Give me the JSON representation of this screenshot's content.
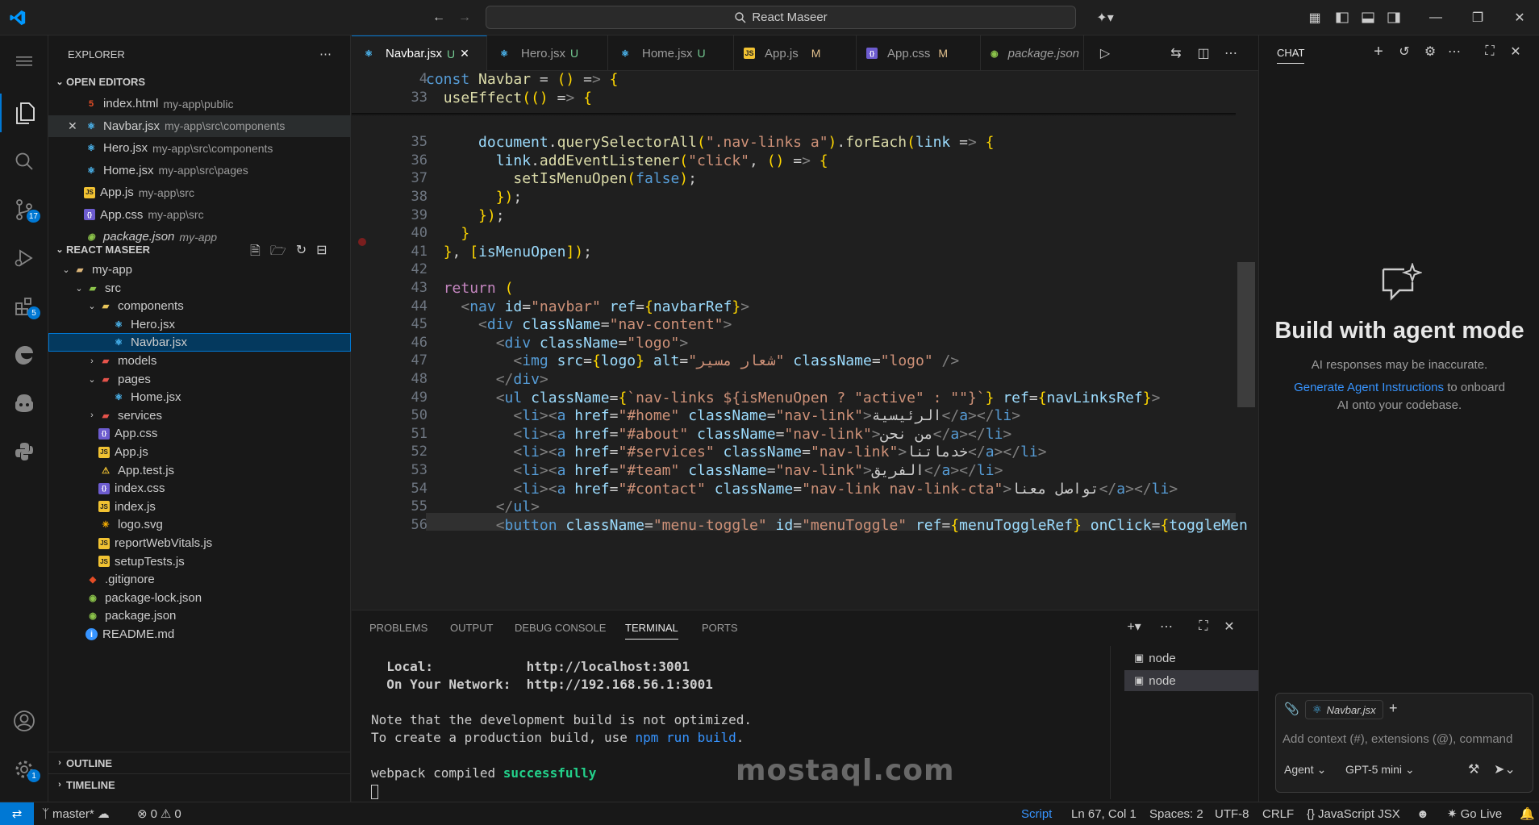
{
  "titlebar": {
    "search_text": "React Maseer"
  },
  "activity": {
    "scm_badge": "17",
    "ext_badge": "5",
    "settings_badge": "1"
  },
  "sidebar": {
    "title": "EXPLORER",
    "open_editors_title": "OPEN EDITORS",
    "open_editors": [
      {
        "name": "index.html",
        "desc": "my-app\\public"
      },
      {
        "name": "Navbar.jsx",
        "desc": "my-app\\src\\components"
      },
      {
        "name": "Hero.jsx",
        "desc": "my-app\\src\\components"
      },
      {
        "name": "Home.jsx",
        "desc": "my-app\\src\\pages"
      },
      {
        "name": "App.js",
        "desc": "my-app\\src"
      },
      {
        "name": "App.css",
        "desc": "my-app\\src"
      },
      {
        "name": "package.json",
        "desc": "my-app"
      }
    ],
    "project_title": "REACT MASEER",
    "tree": [
      "my-app",
      "src",
      "components",
      "Hero.jsx",
      "Navbar.jsx",
      "models",
      "pages",
      "Home.jsx",
      "services",
      "App.css",
      "App.js",
      "App.test.js",
      "index.css",
      "index.js",
      "logo.svg",
      "reportWebVitals.js",
      "setupTests.js",
      ".gitignore",
      "package-lock.json",
      "package.json",
      "README.md"
    ],
    "outline_title": "OUTLINE",
    "timeline_title": "TIMELINE"
  },
  "tabs": [
    {
      "name": "Navbar.jsx",
      "status": "U"
    },
    {
      "name": "Hero.jsx",
      "status": "U"
    },
    {
      "name": "Home.jsx",
      "status": "U"
    },
    {
      "name": "App.js",
      "status": "M"
    },
    {
      "name": "App.css",
      "status": "M"
    },
    {
      "name": "package.json",
      "status": ""
    }
  ],
  "code": {
    "line_numbers": [
      "4",
      "33",
      "35",
      "36",
      "37",
      "38",
      "39",
      "40",
      "41",
      "42",
      "43",
      "44",
      "45",
      "46",
      "47",
      "48",
      "49",
      "50",
      "51",
      "52",
      "53",
      "54",
      "55",
      "56"
    ],
    "lines": [
      "const Navbar = () => {",
      "  useEffect(() => {",
      "      document.querySelectorAll(\".nav-links a\").forEach(link => {",
      "        link.addEventListener(\"click\", () => {",
      "          setIsMenuOpen(false);",
      "        });",
      "      });",
      "    }",
      "  }, [isMenuOpen]);",
      "",
      "  return (",
      "    <nav id=\"navbar\" ref={navbarRef}>",
      "      <div className=\"nav-content\">",
      "        <div className=\"logo\">",
      "          <img src={logo} alt=\"شعار مسير\" className=\"logo\" />",
      "        </div>",
      "        <ul className={`nav-links ${isMenuOpen ? \"active\" : \"\"}`} ref={navLinksRef}>",
      "          <li><a href=\"#home\" className=\"nav-link\">الرئيسية</a></li>",
      "          <li><a href=\"#about\" className=\"nav-link\">من نحن</a></li>",
      "          <li><a href=\"#services\" className=\"nav-link\">خدماتنا</a></li>",
      "          <li><a href=\"#team\" className=\"nav-link\">الفريق</a></li>",
      "          <li><a href=\"#contact\" className=\"nav-link nav-link-cta\">تواصل معنا</a></li>",
      "        </ul>",
      "        <button className=\"menu-toggle\" id=\"menuToggle\" ref={menuToggleRef} onClick={toggleMen"
    ]
  },
  "panel": {
    "tabs": [
      "PROBLEMS",
      "OUTPUT",
      "DEBUG CONSOLE",
      "TERMINAL",
      "PORTS"
    ],
    "terminal_lines": [
      "  Local:            http://localhost:3001",
      "  On Your Network:  http://192.168.56.1:3001",
      "",
      "Note that the development build is not optimized.",
      "To create a production build, use npm run build.",
      "",
      "webpack compiled successfully"
    ],
    "terminals": [
      "node",
      "node"
    ]
  },
  "chat": {
    "header": "CHAT",
    "heading": "Build with agent mode",
    "sub1": "AI responses may be inaccurate.",
    "link": "Generate Agent Instructions",
    "sub2": "to onboard",
    "sub3": "AI onto your codebase.",
    "context_file": "Navbar.jsx",
    "input_placeholder": "Add context (#), extensions (@), command",
    "mode": "Agent",
    "model": "GPT-5 mini"
  },
  "status": {
    "branch": "master*",
    "errors": "0",
    "warnings": "0",
    "script": "Script",
    "position": "Ln 67, Col 1",
    "spaces": "Spaces: 2",
    "encoding": "UTF-8",
    "eol": "CRLF",
    "language": "JavaScript JSX",
    "golive": "Go Live"
  },
  "watermark": {
    "text": "mostaql.com"
  },
  "colors": {
    "accent": "#0078d4",
    "untracked": "#73c991",
    "modified": "#e2c08d",
    "success": "#23d18b"
  }
}
